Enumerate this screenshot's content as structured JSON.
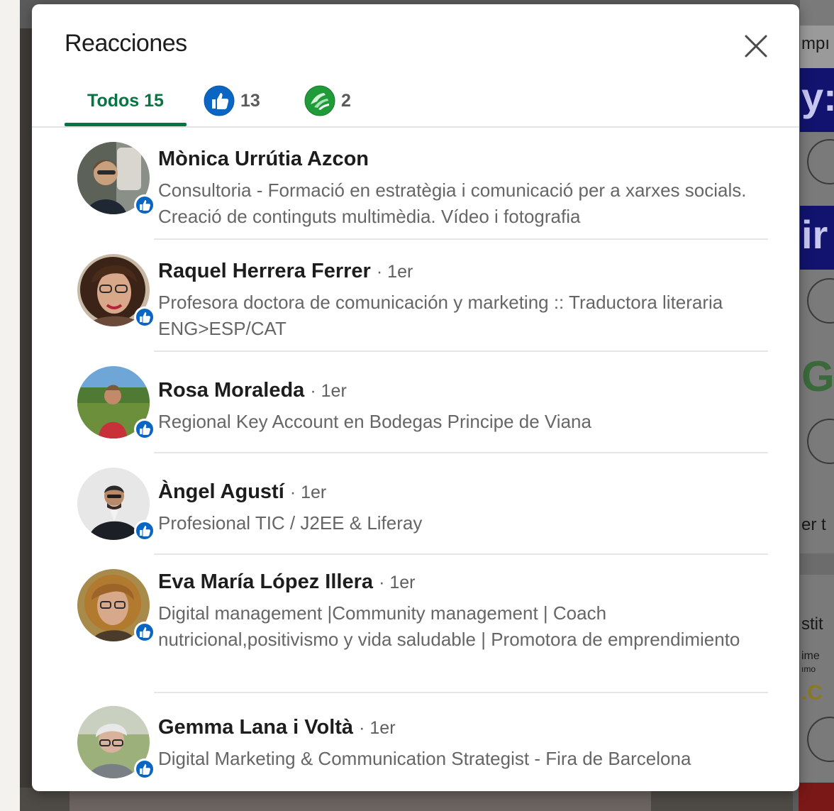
{
  "modal": {
    "title": "Reacciones",
    "close_icon": "close-icon",
    "tabs": [
      {
        "label": "Todos 15",
        "selected": true
      },
      {
        "icon": "like-icon",
        "count": "13",
        "color": "#0a66c2"
      },
      {
        "icon": "support-icon",
        "count": "2",
        "color": "#1f9b3a"
      }
    ]
  },
  "reactors": [
    {
      "name": "Mònica Urrútia Azcon",
      "degree": "",
      "headline": "Consultoria - Formació en estratègia i comunicació per a xarxes socials. Creació de continguts multimèdia. Vídeo i fotografia",
      "reaction_icon": "like-icon"
    },
    {
      "name": "Raquel Herrera Ferrer",
      "degree": "· 1er",
      "headline": "Profesora doctora de comunicación y marketing :: Traductora literaria ENG>ESP/CAT",
      "reaction_icon": "like-icon"
    },
    {
      "name": "Rosa Moraleda",
      "degree": "· 1er",
      "headline": "Regional Key Account en Bodegas Principe de Viana",
      "reaction_icon": "like-icon"
    },
    {
      "name": "Àngel Agustí",
      "degree": "· 1er",
      "headline": "Profesional TIC / J2EE & Liferay",
      "reaction_icon": "like-icon"
    },
    {
      "name": "Eva María López Illera",
      "degree": "· 1er",
      "headline": "Digital management |Community management | Coach nutricional,positivismo y vida saludable | Promotora de emprendimiento",
      "reaction_icon": "like-icon"
    },
    {
      "name": "Gemma Lana i Voltà",
      "degree": "· 1er",
      "headline": "Digital Marketing & Communication Strategist - Fira de Barcelona",
      "reaction_icon": "like-icon"
    }
  ],
  "background": {
    "fragments": [
      "mpı",
      "y:",
      "ir",
      "G",
      "er t",
      "stit",
      "ime",
      "ımo",
      ".C"
    ]
  },
  "colors": {
    "accent": "#057642",
    "like": "#0a66c2",
    "support": "#1f9b3a"
  }
}
